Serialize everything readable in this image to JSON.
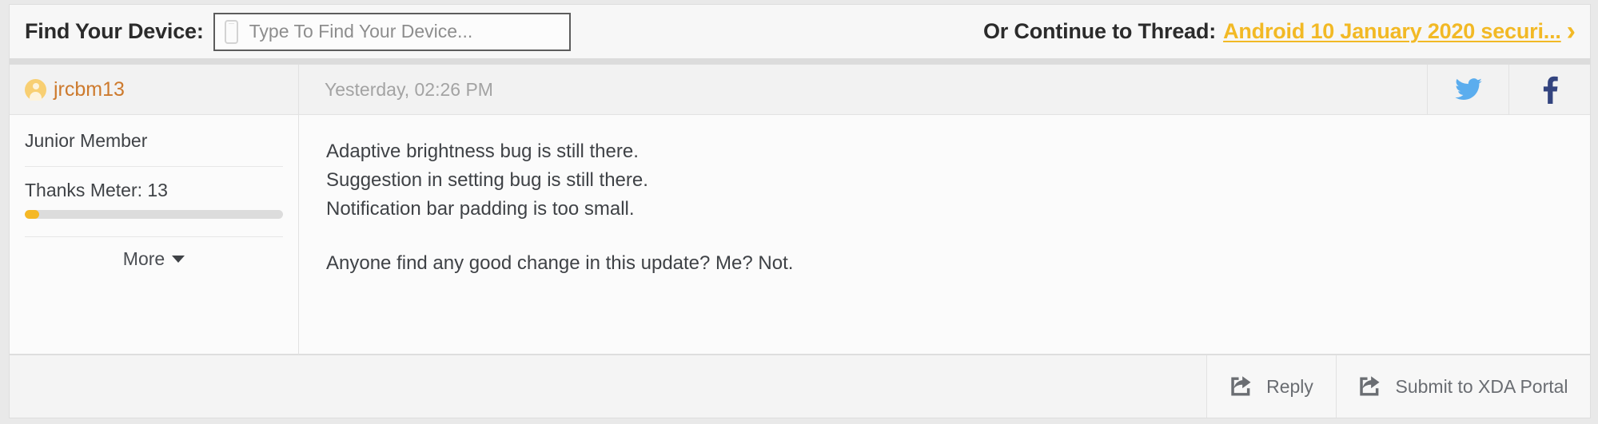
{
  "topbar": {
    "find_label": "Find Your Device:",
    "search_placeholder": "Type To Find Your Device...",
    "search_value": "",
    "phone_icon": "mobile-phone-icon",
    "continue_label": "Or Continue to Thread:",
    "thread_link": "Android 10 January 2020 securi...",
    "chevron": "›",
    "link_color": "#f2b925"
  },
  "post": {
    "author": "jrcbm13",
    "author_color": "#cd7a2d",
    "avatar_icon": "user-avatar-icon",
    "timestamp": "Yesterday, 02:26 PM",
    "social": {
      "twitter_icon": "twitter-bird-icon",
      "twitter_color": "#5badee",
      "facebook_icon": "facebook-f-icon",
      "facebook_color": "#33447f"
    },
    "sidebar": {
      "member_title": "Junior Member",
      "thanks_label": "Thanks Meter: 13",
      "thanks_count": 13,
      "meter_percent": 5,
      "meter_color": "#f5b825",
      "more_label": "More",
      "more_icon": "chevron-down-icon"
    },
    "body": {
      "line1": "Adaptive brightness bug is still there.",
      "line2": "Suggestion in setting bug is still there.",
      "line3": "Notification bar padding is too small.",
      "line4": "Anyone find any good change in this update? Me? Not."
    }
  },
  "footer": {
    "reply_label": "Reply",
    "reply_icon": "share-arrow-icon",
    "portal_label": "Submit to XDA Portal",
    "portal_icon": "share-arrow-icon"
  }
}
